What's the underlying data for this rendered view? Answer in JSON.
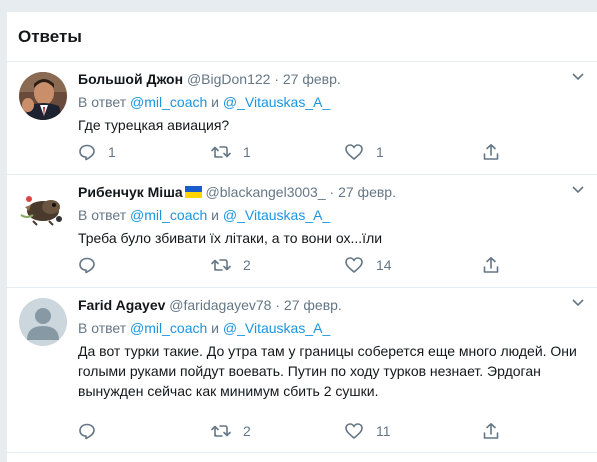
{
  "header": {
    "title": "Ответы"
  },
  "tweets": [
    {
      "name": "Большой Джон",
      "handle": "@BigDon122",
      "date": "27 февр.",
      "reply_prefix": "В ответ",
      "reply_user1": "@mil_coach",
      "reply_conj": "и",
      "reply_user2": "@_Vitauskas_A_",
      "text": "Где турецкая авиация?",
      "replies": "1",
      "retweets": "1",
      "likes": "1"
    },
    {
      "name": "Рибенчук Міша",
      "handle": "@blackangel3003_",
      "date": "27 февр.",
      "reply_prefix": "В ответ",
      "reply_user1": "@mil_coach",
      "reply_conj": "и",
      "reply_user2": "@_Vitauskas_A_",
      "text": "Треба було збивати їх літаки, а то вони ох...їли",
      "replies": "",
      "retweets": "2",
      "likes": "14"
    },
    {
      "name": "Farid Agayev",
      "handle": "@faridagayev78",
      "date": "27 февр.",
      "reply_prefix": "В ответ",
      "reply_user1": "@mil_coach",
      "reply_conj": "и",
      "reply_user2": "@_Vitauskas_A_",
      "text": "Да вот турки такие. До утра там у границы соберется еще много людей. Они голыми руками пойдут воевать. Путин по ходу турков незнает. Эрдоган вынужден сейчас как минимум сбить 2 сушки.",
      "replies": "",
      "retweets": "2",
      "likes": "11"
    }
  ],
  "icons": {
    "reply": "reply-icon",
    "retweet": "retweet-icon",
    "like": "heart-icon",
    "share": "share-icon",
    "caret": "chevron-down-icon",
    "flag": "ukraine-flag-icon"
  },
  "colors": {
    "link": "#1b95e0",
    "secondary_text": "#657786",
    "primary_text": "#14171a",
    "background": "#e6ecf0"
  }
}
